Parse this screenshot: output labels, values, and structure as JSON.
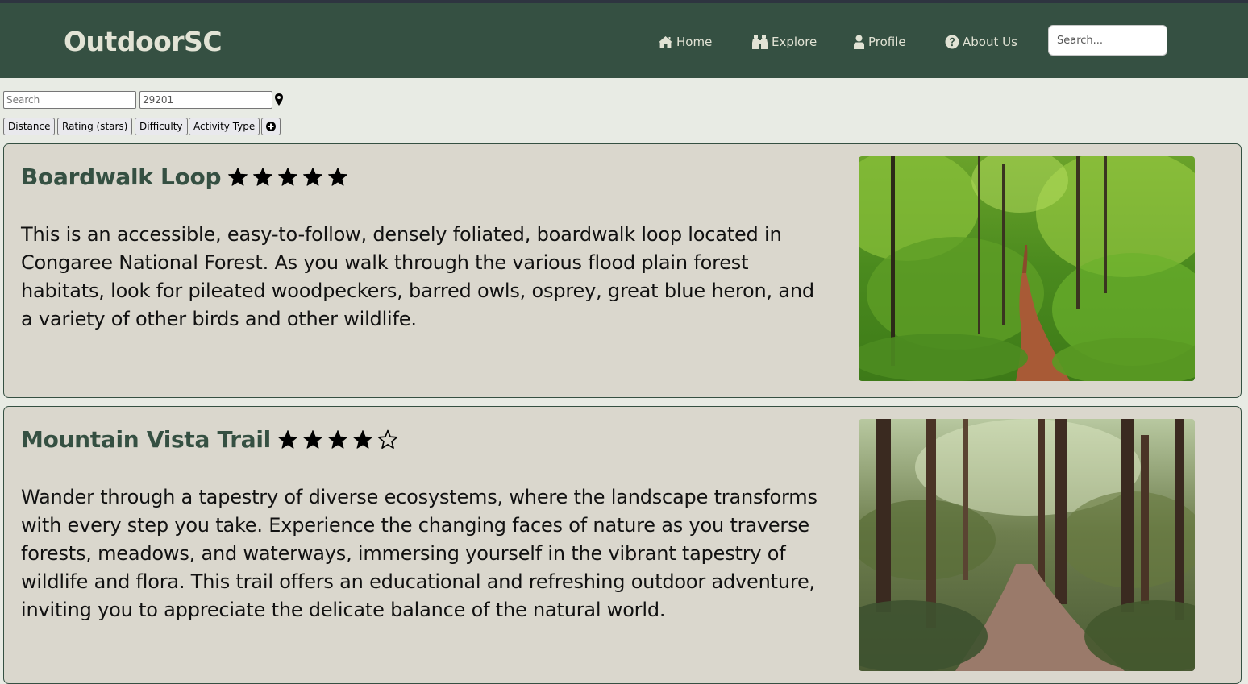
{
  "nav": {
    "brand": "OutdoorSC",
    "items": [
      {
        "label": "Home",
        "icon": "home-icon"
      },
      {
        "label": "Explore",
        "icon": "binoculars-icon"
      },
      {
        "label": "Profile",
        "icon": "user-icon"
      },
      {
        "label": "About Us",
        "icon": "question-circle-icon"
      }
    ],
    "search_placeholder": "Search..."
  },
  "filters": {
    "search_placeholder": "Search",
    "zip_value": "29201",
    "location_icon": "map-pin-icon",
    "chips": [
      "Distance",
      "Rating (stars)",
      "Difficulty",
      "Activity Type"
    ],
    "add_icon": "plus-circle-icon"
  },
  "trails": [
    {
      "name": "Boardwalk Loop",
      "rating": 5,
      "rating_max": 5,
      "description": "This is an accessible, easy-to-follow, densely foliated, boardwalk loop located in Congaree National Forest. As you walk through the various flood plain forest habitats, look for pileated woodpeckers, barred owls, osprey, great blue heron, and a variety of other birds and other wildlife.",
      "image": "lush green forest trail photo"
    },
    {
      "name": "Mountain Vista Trail",
      "rating": 4,
      "rating_max": 5,
      "description": "Wander through a tapestry of diverse ecosystems, where the landscape transforms with every step you take. Experience the changing faces of nature as you traverse forests, meadows, and waterways, immersing yourself in the vibrant tapestry of wildlife and flora. This trail offers an educational and refreshing outdoor adventure, inviting you to appreciate the delicate balance of the natural world.",
      "image": "pine forest trail photo"
    }
  ],
  "colors": {
    "navbar": "#355042",
    "nav_text": "#e2e3d5",
    "page_bg": "#e8ebe4",
    "card_bg": "#dad7cd",
    "title": "#355042"
  }
}
